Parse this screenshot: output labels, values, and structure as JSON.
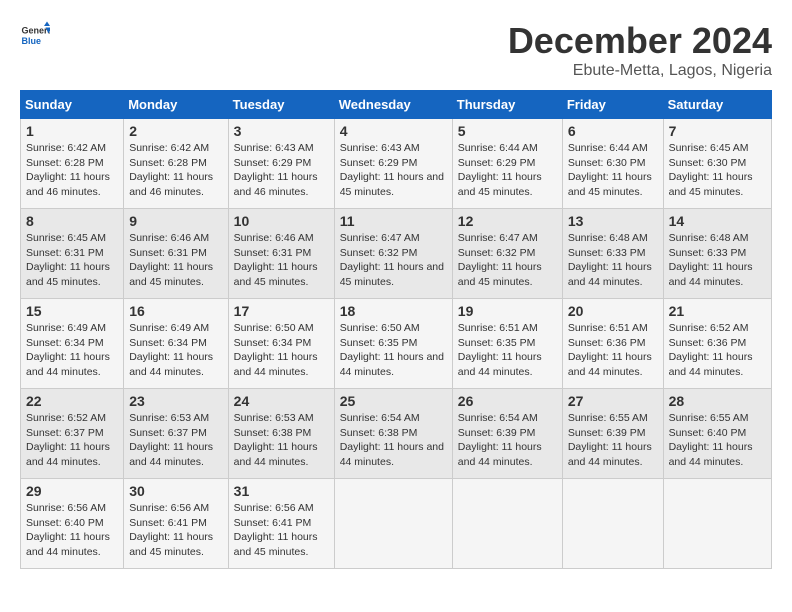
{
  "logo": {
    "general": "General",
    "blue": "Blue"
  },
  "title": "December 2024",
  "subtitle": "Ebute-Metta, Lagos, Nigeria",
  "headers": [
    "Sunday",
    "Monday",
    "Tuesday",
    "Wednesday",
    "Thursday",
    "Friday",
    "Saturday"
  ],
  "weeks": [
    [
      {
        "day": "1",
        "sunrise": "6:42 AM",
        "sunset": "6:28 PM",
        "daylight": "11 hours and 46 minutes."
      },
      {
        "day": "2",
        "sunrise": "6:42 AM",
        "sunset": "6:28 PM",
        "daylight": "11 hours and 46 minutes."
      },
      {
        "day": "3",
        "sunrise": "6:43 AM",
        "sunset": "6:29 PM",
        "daylight": "11 hours and 46 minutes."
      },
      {
        "day": "4",
        "sunrise": "6:43 AM",
        "sunset": "6:29 PM",
        "daylight": "11 hours and 45 minutes."
      },
      {
        "day": "5",
        "sunrise": "6:44 AM",
        "sunset": "6:29 PM",
        "daylight": "11 hours and 45 minutes."
      },
      {
        "day": "6",
        "sunrise": "6:44 AM",
        "sunset": "6:30 PM",
        "daylight": "11 hours and 45 minutes."
      },
      {
        "day": "7",
        "sunrise": "6:45 AM",
        "sunset": "6:30 PM",
        "daylight": "11 hours and 45 minutes."
      }
    ],
    [
      {
        "day": "8",
        "sunrise": "6:45 AM",
        "sunset": "6:31 PM",
        "daylight": "11 hours and 45 minutes."
      },
      {
        "day": "9",
        "sunrise": "6:46 AM",
        "sunset": "6:31 PM",
        "daylight": "11 hours and 45 minutes."
      },
      {
        "day": "10",
        "sunrise": "6:46 AM",
        "sunset": "6:31 PM",
        "daylight": "11 hours and 45 minutes."
      },
      {
        "day": "11",
        "sunrise": "6:47 AM",
        "sunset": "6:32 PM",
        "daylight": "11 hours and 45 minutes."
      },
      {
        "day": "12",
        "sunrise": "6:47 AM",
        "sunset": "6:32 PM",
        "daylight": "11 hours and 45 minutes."
      },
      {
        "day": "13",
        "sunrise": "6:48 AM",
        "sunset": "6:33 PM",
        "daylight": "11 hours and 44 minutes."
      },
      {
        "day": "14",
        "sunrise": "6:48 AM",
        "sunset": "6:33 PM",
        "daylight": "11 hours and 44 minutes."
      }
    ],
    [
      {
        "day": "15",
        "sunrise": "6:49 AM",
        "sunset": "6:34 PM",
        "daylight": "11 hours and 44 minutes."
      },
      {
        "day": "16",
        "sunrise": "6:49 AM",
        "sunset": "6:34 PM",
        "daylight": "11 hours and 44 minutes."
      },
      {
        "day": "17",
        "sunrise": "6:50 AM",
        "sunset": "6:34 PM",
        "daylight": "11 hours and 44 minutes."
      },
      {
        "day": "18",
        "sunrise": "6:50 AM",
        "sunset": "6:35 PM",
        "daylight": "11 hours and 44 minutes."
      },
      {
        "day": "19",
        "sunrise": "6:51 AM",
        "sunset": "6:35 PM",
        "daylight": "11 hours and 44 minutes."
      },
      {
        "day": "20",
        "sunrise": "6:51 AM",
        "sunset": "6:36 PM",
        "daylight": "11 hours and 44 minutes."
      },
      {
        "day": "21",
        "sunrise": "6:52 AM",
        "sunset": "6:36 PM",
        "daylight": "11 hours and 44 minutes."
      }
    ],
    [
      {
        "day": "22",
        "sunrise": "6:52 AM",
        "sunset": "6:37 PM",
        "daylight": "11 hours and 44 minutes."
      },
      {
        "day": "23",
        "sunrise": "6:53 AM",
        "sunset": "6:37 PM",
        "daylight": "11 hours and 44 minutes."
      },
      {
        "day": "24",
        "sunrise": "6:53 AM",
        "sunset": "6:38 PM",
        "daylight": "11 hours and 44 minutes."
      },
      {
        "day": "25",
        "sunrise": "6:54 AM",
        "sunset": "6:38 PM",
        "daylight": "11 hours and 44 minutes."
      },
      {
        "day": "26",
        "sunrise": "6:54 AM",
        "sunset": "6:39 PM",
        "daylight": "11 hours and 44 minutes."
      },
      {
        "day": "27",
        "sunrise": "6:55 AM",
        "sunset": "6:39 PM",
        "daylight": "11 hours and 44 minutes."
      },
      {
        "day": "28",
        "sunrise": "6:55 AM",
        "sunset": "6:40 PM",
        "daylight": "11 hours and 44 minutes."
      }
    ],
    [
      {
        "day": "29",
        "sunrise": "6:56 AM",
        "sunset": "6:40 PM",
        "daylight": "11 hours and 44 minutes."
      },
      {
        "day": "30",
        "sunrise": "6:56 AM",
        "sunset": "6:41 PM",
        "daylight": "11 hours and 45 minutes."
      },
      {
        "day": "31",
        "sunrise": "6:56 AM",
        "sunset": "6:41 PM",
        "daylight": "11 hours and 45 minutes."
      },
      null,
      null,
      null,
      null
    ]
  ]
}
